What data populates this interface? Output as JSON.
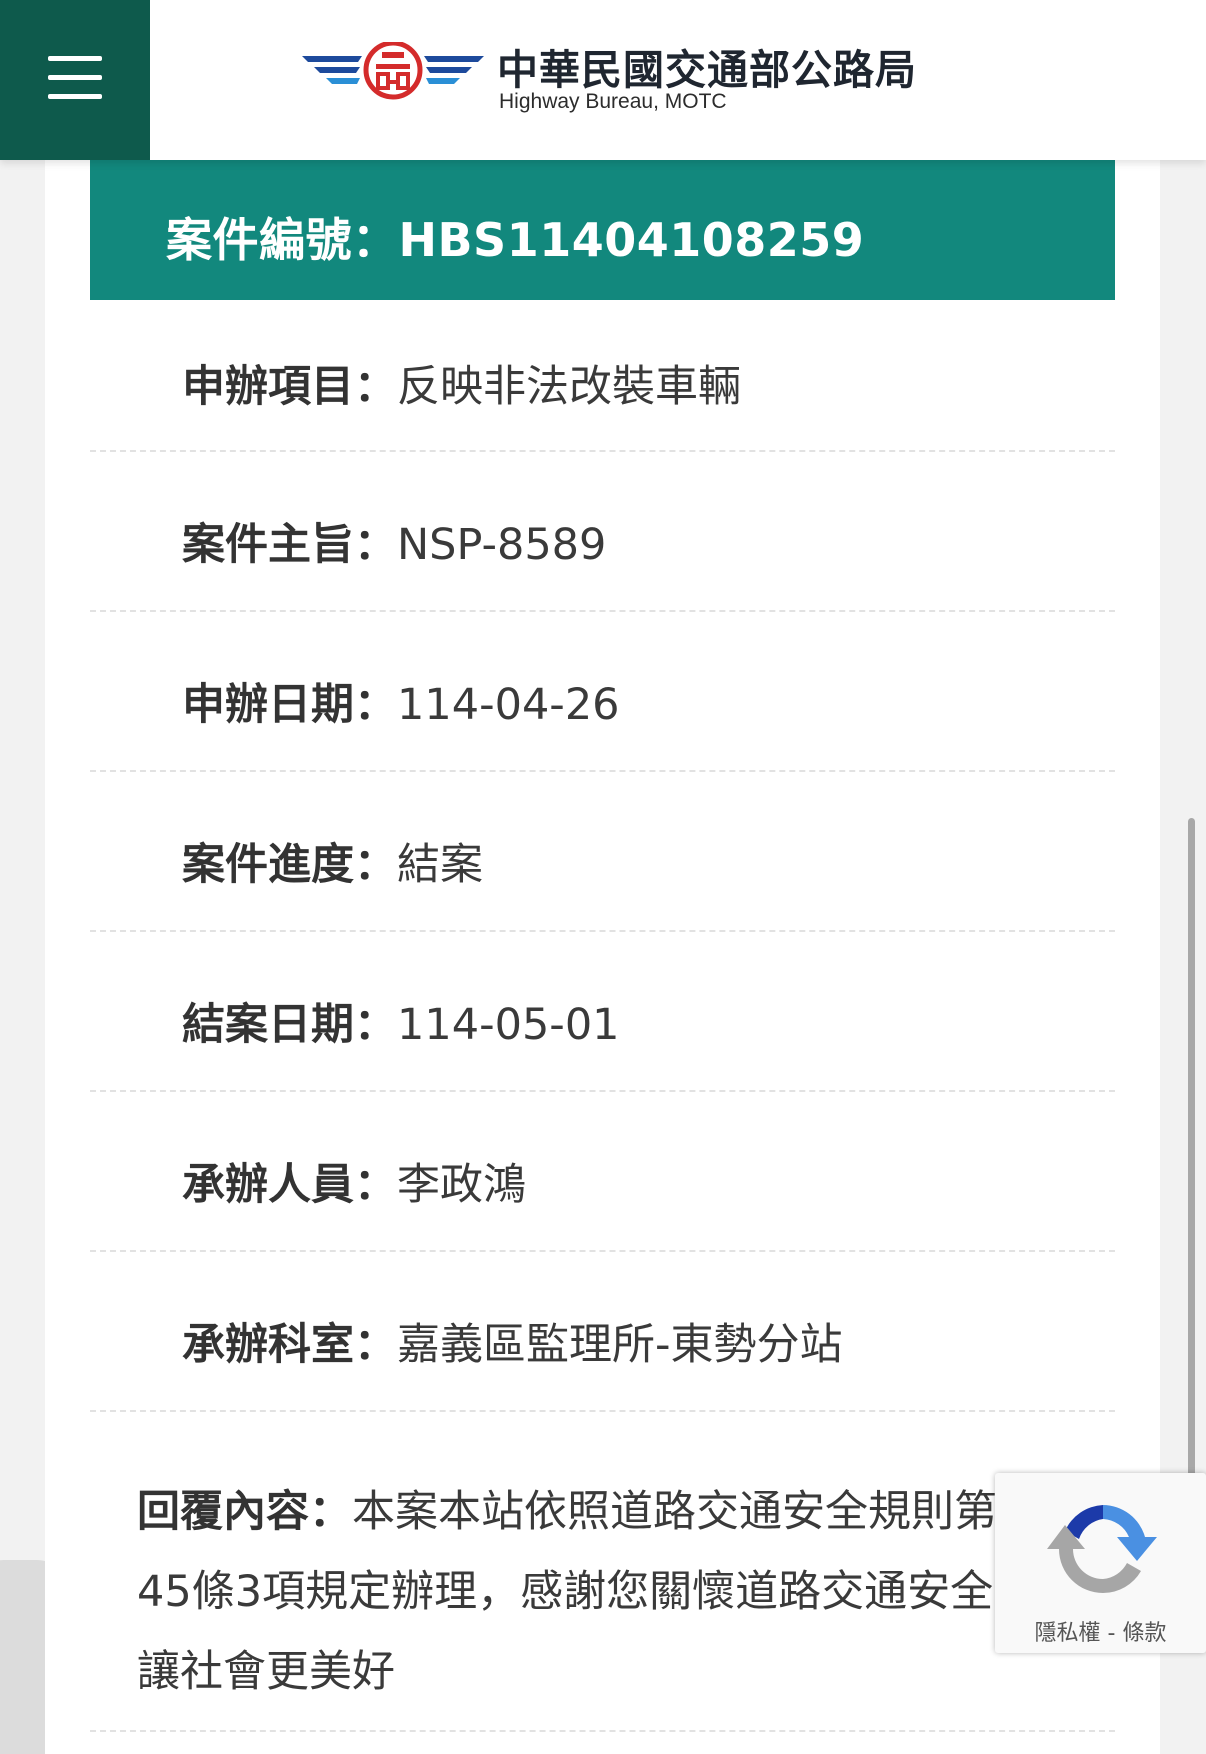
{
  "header": {
    "menu_icon": "hamburger-menu-icon",
    "logo_icon": "highway-bureau-wings-emblem",
    "title_cn": "中華民國交通部公路局",
    "title_en": "Highway Bureau, MOTC"
  },
  "case": {
    "number_label": "案件編號：",
    "number": "HBS11404108259",
    "rows": [
      {
        "label": "申辦項目",
        "value": "反映非法改裝車輛"
      },
      {
        "label": "案件主旨",
        "value": "NSP-8589"
      },
      {
        "label": "申辦日期",
        "value": "114-04-26"
      },
      {
        "label": "案件進度",
        "value": "結案"
      },
      {
        "label": "結案日期",
        "value": "114-05-01"
      },
      {
        "label": "承辦人員",
        "value": "李政鴻"
      },
      {
        "label": "承辦科室",
        "value": "嘉義區監理所-東勢分站"
      }
    ],
    "reply_label": "回覆內容",
    "reply_text": "本案本站依照道路交通安全規則第45條3項規定辦理，感謝您關懷道路交通安全，讓社會更美好"
  },
  "separator": "：",
  "recaptcha": {
    "icon": "recaptcha-logo-icon",
    "privacy": "隱私權",
    "dash": " - ",
    "terms": "條款"
  },
  "colors": {
    "header_green": "#0e5a4c",
    "case_bar_teal": "#12887d"
  }
}
